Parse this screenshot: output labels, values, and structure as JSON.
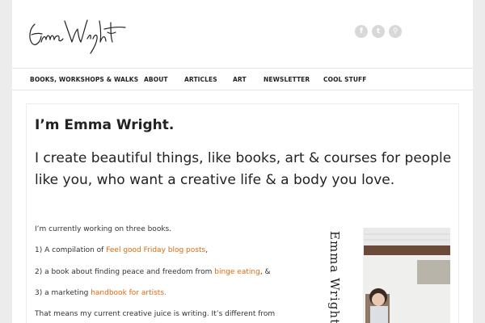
{
  "header": {
    "logo_text": "EmmaWright",
    "social": [
      {
        "icon": "facebook-icon",
        "glyph": "f"
      },
      {
        "icon": "twitter-icon",
        "glyph": "t"
      },
      {
        "icon": "search-icon",
        "glyph": "⚲"
      }
    ]
  },
  "nav": {
    "items": [
      {
        "label": "BOOKS, WORKSHOPS & WALKS"
      },
      {
        "label": "ABOUT"
      },
      {
        "label": "ARTICLES"
      },
      {
        "label": "ART"
      },
      {
        "label": "NEWSLETTER"
      },
      {
        "label": "COOL STUFF"
      }
    ]
  },
  "main": {
    "intro": "I’m Emma Wright.",
    "tagline": "I create beautiful things, like books, art & courses for people like you, who want a creative life & a body you love.",
    "p1": "I’m currently working on three books.",
    "p2_pre": "1) A compilation of ",
    "p2_link": "Feel good Friday blog posts",
    "p2_post": ",",
    "p3_pre": "2) a book about finding peace and freedom from ",
    "p3_link": "binge eating",
    "p3_post": ", &",
    "p4_pre": "3) a marketing ",
    "p4_link": "handbook for artists.",
    "p5": "That means my current creative juice is writing.  It’s different  from",
    "photo_text": "Emma Wright"
  },
  "colors": {
    "link": "#e06a0f",
    "social_bg": "#d8d8d8"
  }
}
